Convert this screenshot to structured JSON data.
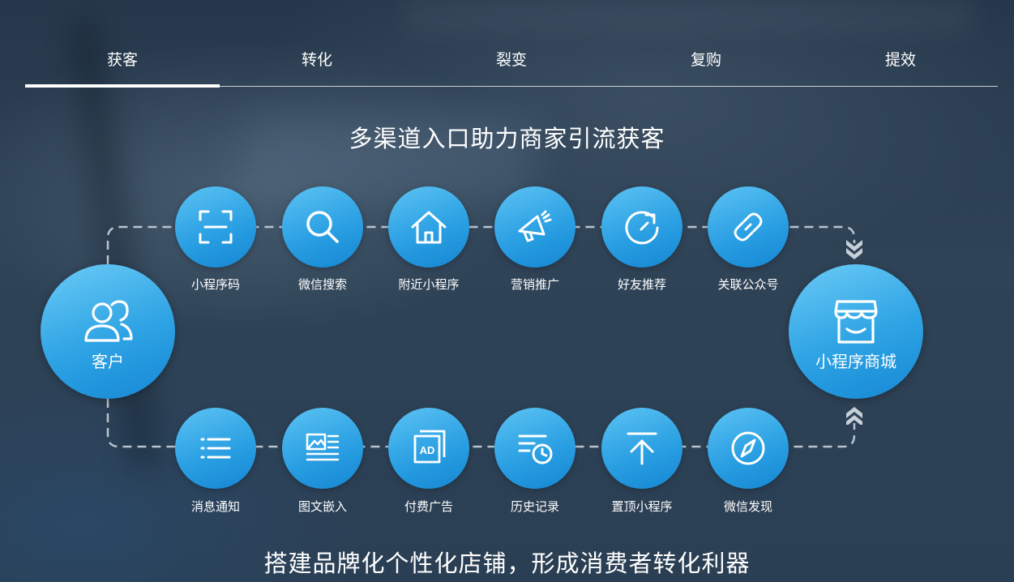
{
  "tabs": [
    "获客",
    "转化",
    "裂变",
    "复购",
    "提效"
  ],
  "active_tab": 0,
  "title": "多渠道入口助力商家引流获客",
  "bottom_title": "搭建品牌化个性化店铺，形成消费者转化利器",
  "customer": {
    "label": "客户",
    "icon": "users-icon"
  },
  "store": {
    "label": "小程序商城",
    "icon": "store-icon"
  },
  "top_channels": [
    {
      "label": "小程序码",
      "icon": "scan-icon"
    },
    {
      "label": "微信搜索",
      "icon": "search-icon"
    },
    {
      "label": "附近小程序",
      "icon": "home-icon"
    },
    {
      "label": "营销推广",
      "icon": "megaphone-icon"
    },
    {
      "label": "好友推荐",
      "icon": "refresh-icon"
    },
    {
      "label": "关联公众号",
      "icon": "link-icon"
    }
  ],
  "bottom_channels": [
    {
      "label": "消息通知",
      "icon": "list-icon"
    },
    {
      "label": "图文嵌入",
      "icon": "image-text-icon"
    },
    {
      "label": "付费广告",
      "icon": "ad-icon"
    },
    {
      "label": "历史记录",
      "icon": "history-icon"
    },
    {
      "label": "置顶小程序",
      "icon": "pin-top-icon"
    },
    {
      "label": "微信发现",
      "icon": "compass-icon"
    }
  ],
  "colors": {
    "node_light": "#5cc3f3",
    "node_dark": "#1486d2",
    "connector": "#b9c4cf"
  }
}
